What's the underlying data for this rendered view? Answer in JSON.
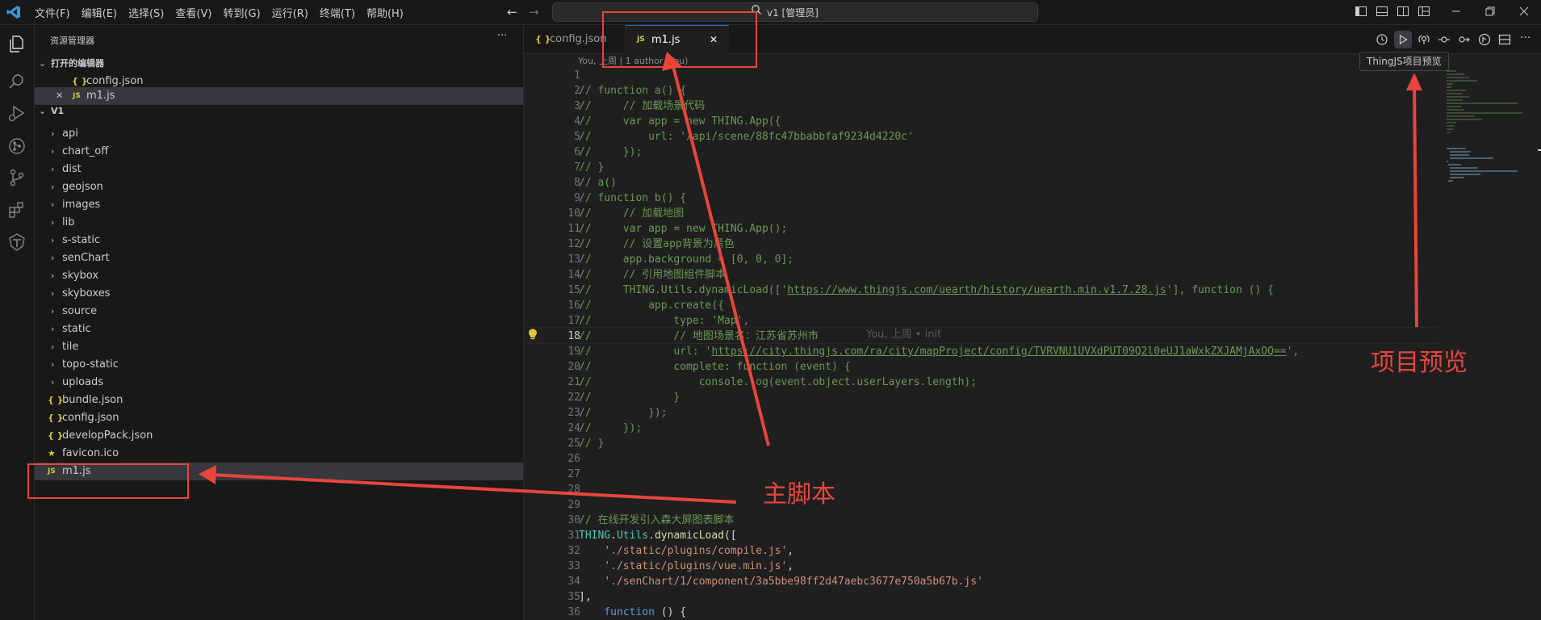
{
  "titlebar": {
    "menu": [
      "文件(F)",
      "编辑(E)",
      "选择(S)",
      "查看(V)",
      "转到(G)",
      "运行(R)",
      "终端(T)",
      "帮助(H)"
    ],
    "search": "v1 [管理员]"
  },
  "sidebar": {
    "title": "资源管理器",
    "more": "···",
    "open_editors_label": "打开的编辑器",
    "open_editors": [
      {
        "name": "config.json",
        "icon": "json-icon",
        "prefix": "{ }"
      },
      {
        "name": "m1.js",
        "icon": "js-icon",
        "prefix": "JS",
        "close": "✕"
      }
    ],
    "folder_label": "V1",
    "tree": [
      {
        "name": "api",
        "type": "folder"
      },
      {
        "name": "chart_off",
        "type": "folder"
      },
      {
        "name": "dist",
        "type": "folder"
      },
      {
        "name": "geojson",
        "type": "folder"
      },
      {
        "name": "images",
        "type": "folder"
      },
      {
        "name": "lib",
        "type": "folder"
      },
      {
        "name": "s-static",
        "type": "folder"
      },
      {
        "name": "senChart",
        "type": "folder"
      },
      {
        "name": "skybox",
        "type": "folder"
      },
      {
        "name": "skyboxes",
        "type": "folder"
      },
      {
        "name": "source",
        "type": "folder"
      },
      {
        "name": "static",
        "type": "folder"
      },
      {
        "name": "tile",
        "type": "folder"
      },
      {
        "name": "topo-static",
        "type": "folder"
      },
      {
        "name": "uploads",
        "type": "folder"
      },
      {
        "name": "bundle.json",
        "type": "json"
      },
      {
        "name": "config.json",
        "type": "json"
      },
      {
        "name": "developPack.json",
        "type": "json"
      },
      {
        "name": "favicon.ico",
        "type": "star"
      },
      {
        "name": "m1.js",
        "type": "js"
      }
    ]
  },
  "editor": {
    "tabs": [
      {
        "label": "config.json",
        "prefix": "{ }"
      },
      {
        "label": "m1.js",
        "prefix": "JS",
        "close": "✕"
      }
    ],
    "codelens": "You, 上周 | 1 author (You)",
    "blame": "You, 上周 • init",
    "current_line": 18,
    "lines": [
      "",
      "// function a() {",
      "//     // 加载场景代码",
      "//     var app = new THING.App({",
      "//         url: '/api/scene/88fc47bbabbfaf9234d4220c'",
      "//     });",
      "// }",
      "// a()",
      "// function b() {",
      "//     // 加载地图",
      "//     var app = new THING.App();",
      "//     // 设置app背景为黑色",
      "//     app.background = [0, 0, 0];",
      "//     // 引用地图组件脚本",
      "//     THING.Utils.dynamicLoad(['https://www.thingjs.com/uearth/history/uearth.min.v1.7.28.js'], function () {",
      "//         app.create({",
      "//             type: 'Map',",
      "//             // 地图场景名：江苏省苏州市",
      "//             url: 'https://city.thingjs.com/ra/city/mapProject/config/TVRVNU1UVXdPUT09Q2l0eUJ1aWxkZXJAMjAxOQ==',",
      "//             complete: function (event) {",
      "//                 console.log(event.object.userLayers.length);",
      "//             }",
      "//         });",
      "//     });",
      "// }",
      "",
      "",
      "",
      "",
      "// 在线开发引入森大屏图表脚本",
      "THING.Utils.dynamicLoad([",
      "    './static/plugins/compile.js',",
      "    './static/plugins/vue.min.js',",
      "    './senChart/1/component/3a5bbe98ff2d47aebc3677e750a5b67b.js'",
      "],",
      "    function () {"
    ],
    "line_numbers": [
      "1",
      "2",
      "3",
      "4",
      "5",
      "6",
      "7",
      "8",
      "9",
      "10",
      "11",
      "12",
      "13",
      "14",
      "15",
      "16",
      "17",
      "18",
      "19",
      "20",
      "21",
      "22",
      "23",
      "24",
      "25",
      "26",
      "27",
      "28",
      "29",
      "30",
      "31",
      "32",
      "33",
      "34",
      "35",
      "36"
    ]
  },
  "tooltip": "ThingJS项目预览",
  "annotations": {
    "main_script": "主脚本",
    "project_preview": "项目预览",
    "color": "#e8453c"
  }
}
